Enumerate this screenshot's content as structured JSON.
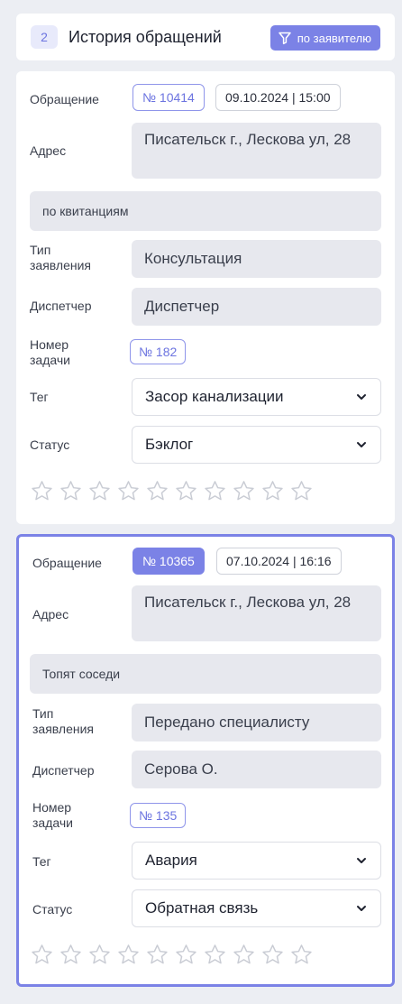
{
  "header": {
    "count": "2",
    "title": "История обращений",
    "filter_label": "по заявителю",
    "filter_icon": "funnel-icon"
  },
  "labels": {
    "appeal": "Обращение",
    "address": "Адрес",
    "type": "Тип заявления",
    "dispatcher": "Диспетчер",
    "task_number": "Номер задачи",
    "tag": "Тег",
    "status": "Статус"
  },
  "cards": [
    {
      "number": "№ 10414",
      "datetime": "09.10.2024 | 15:00",
      "address": "Писательск г., Лескова ул, 28",
      "comment": "по квитанциям",
      "type": "Консультация",
      "dispatcher": "Диспетчер",
      "task_number": "№ 182",
      "tag": "Засор канализации",
      "status": "Бэклог",
      "rating": 0,
      "rating_max": 10,
      "active": false
    },
    {
      "number": "№ 10365",
      "datetime": "07.10.2024 | 16:16",
      "address": "Писательск г., Лескова ул, 28",
      "comment": "Топят соседи",
      "type": "Передано специалисту",
      "dispatcher": "Серова О.",
      "task_number": "№ 135",
      "tag": "Авария",
      "status": "Обратная связь",
      "rating": 0,
      "rating_max": 10,
      "active": true
    }
  ],
  "colors": {
    "accent": "#7b82e6",
    "background": "#eceef3",
    "field": "#e7e8ee"
  }
}
